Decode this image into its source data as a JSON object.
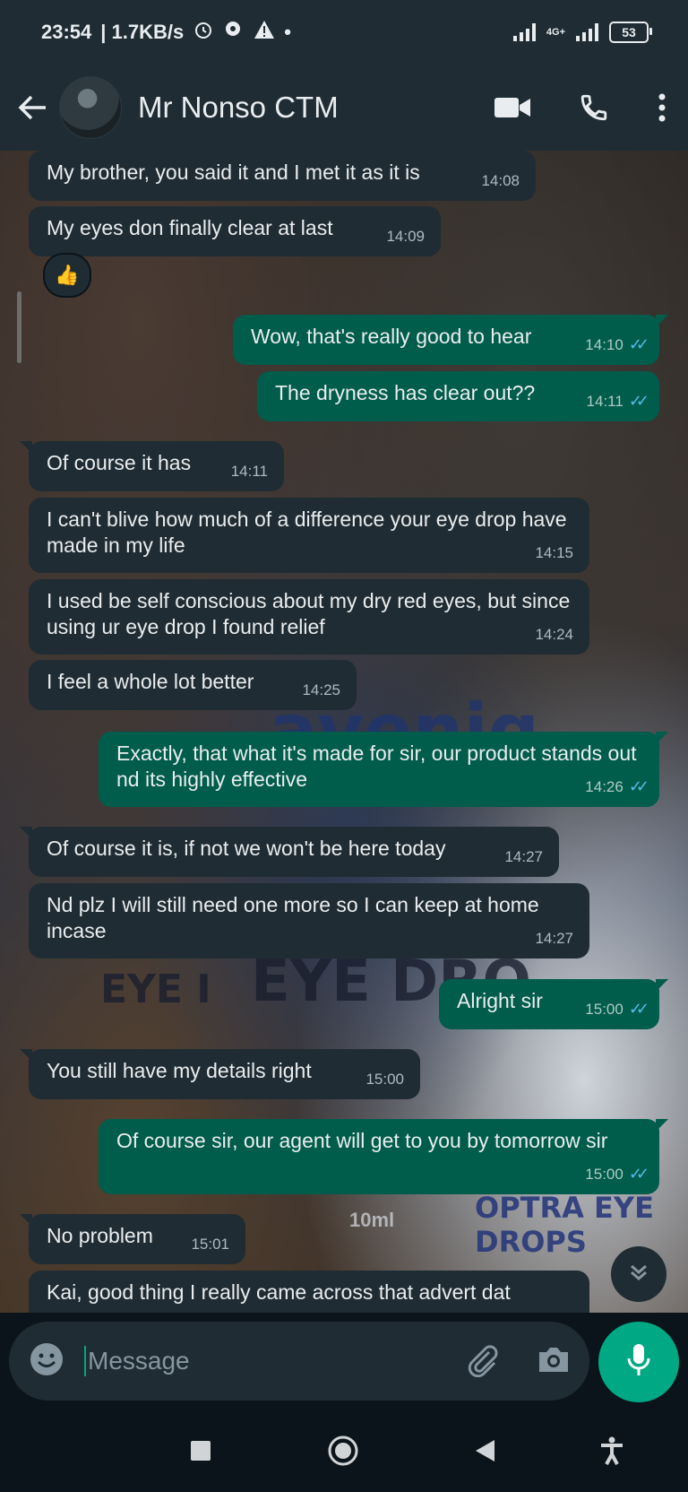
{
  "status_bar": {
    "time": "23:54",
    "speed": "| 1.7KB/s",
    "network": "4G+",
    "battery": "53"
  },
  "header": {
    "contact_name": "Mr Nonso CTM"
  },
  "background_text": {
    "brand": "aveniq",
    "product": "EYE DRO",
    "product2": "EYE I",
    "label": "OPTRA EYE DROPS",
    "volume": "10ml"
  },
  "messages": [
    {
      "dir": "in",
      "text": "My brother, you said it and I met it as it is",
      "time": "14:08"
    },
    {
      "dir": "in",
      "text": "My eyes don finally clear at last",
      "time": "14:09",
      "reaction": "👍"
    },
    {
      "dir": "out",
      "text": "Wow, that's really good to hear",
      "time": "14:10"
    },
    {
      "dir": "out",
      "text": "The dryness has clear out??",
      "time": "14:11"
    },
    {
      "dir": "in",
      "text": "Of course it has",
      "time": "14:11"
    },
    {
      "dir": "in",
      "text": "I can't blive how much of a difference your eye drop have made in my life",
      "time": "14:15"
    },
    {
      "dir": "in",
      "text": "I used be self conscious about my dry red eyes, but since using ur eye drop I found relief",
      "time": "14:24"
    },
    {
      "dir": "in",
      "text": "I feel a whole lot better",
      "time": "14:25"
    },
    {
      "dir": "out",
      "text": "Exactly, that what it's made for sir, our product stands out nd its highly effective",
      "time": "14:26"
    },
    {
      "dir": "in",
      "text": "Of course it is, if not we won't be here today",
      "time": "14:27"
    },
    {
      "dir": "in",
      "text": "Nd plz I will still need one more so I can keep at home incase",
      "time": "14:27"
    },
    {
      "dir": "out",
      "text": "Alright sir",
      "time": "15:00"
    },
    {
      "dir": "in",
      "text": "You still have my details right",
      "time": "15:00"
    },
    {
      "dir": "out",
      "text": "Of course sir, our agent will get to you by tomorrow sir",
      "time": "15:00"
    },
    {
      "dir": "in",
      "text": "No problem",
      "time": "15:01"
    },
    {
      "dir": "in",
      "text": "Kai, good thing I really came across that advert dat",
      "time": ""
    }
  ],
  "input": {
    "placeholder": "Message",
    "value": ""
  },
  "colors": {
    "incoming_bubble": "#202c33",
    "outgoing_bubble": "#005c4b",
    "accent": "#00a884",
    "read_ticks": "#53bdeb"
  }
}
